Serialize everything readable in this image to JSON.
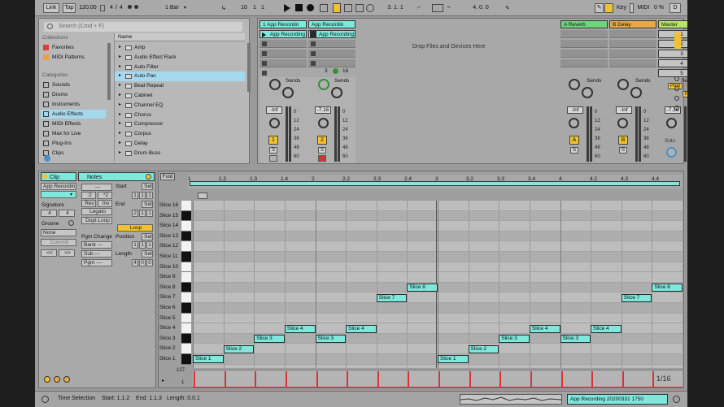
{
  "transport": {
    "link": "Link",
    "tap": "Tap",
    "tempo": "120.00",
    "sig_num": "4",
    "sig_den": "4",
    "quantize": "1 Bar",
    "arr_pos_a": "10",
    "arr_pos_b": "1",
    "arr_pos_c": "1",
    "loop_start": "3. 1. 1",
    "loop_len": "4. 0. 0",
    "key": "Key",
    "midi": "MIDI",
    "cpu": "0 %",
    "d_label": "D"
  },
  "browser": {
    "search_placeholder": "Search (Cmd + F)",
    "collections_head": "Collections",
    "collections": [
      {
        "label": "Favorites",
        "color": "#e03a3a"
      },
      {
        "label": "MIDI Patterns",
        "color": "#e8a03a"
      }
    ],
    "categories_head": "Categories",
    "categories": [
      "Sounds",
      "Drums",
      "Instruments",
      "Audio Effects",
      "MIDI Effects",
      "Max for Live",
      "Plug-Ins",
      "Clips"
    ],
    "selected_category": "Audio Effects",
    "name_head": "Name",
    "items": [
      "Amp",
      "Audio Effect Rack",
      "Auto Filter",
      "Auto Pan",
      "Beat Repeat",
      "Cabinet",
      "Channel EQ",
      "Chorus",
      "Compressor",
      "Corpus",
      "Delay",
      "Drum Buss"
    ],
    "selected_item": "Auto Pan"
  },
  "session": {
    "drop_hint": "Drop Files and Devices Here",
    "tracks": [
      {
        "name": "1 App Recordin",
        "clip": "App Recording",
        "num": "1",
        "vol": "-Inf",
        "color": "#7ee8dc"
      },
      {
        "name": "App Recordin",
        "clip": "App Recording",
        "num": "2",
        "vol": "-7.16",
        "color": "#7ee8dc"
      }
    ],
    "returns": [
      {
        "name": "A Reverb",
        "num": "A",
        "vol": "-Inf",
        "color": "#6ed67a"
      },
      {
        "name": "B Delay",
        "num": "B",
        "vol": "-Inf",
        "color": "#e8a848"
      }
    ],
    "master": {
      "name": "Master",
      "vol": "-7.16",
      "scenes": [
        "1",
        "2",
        "3",
        "4",
        "5"
      ],
      "post": "Post",
      "solo": "Solo"
    },
    "sends_label": "Sends",
    "db_marks": [
      "0",
      "12",
      "24",
      "36",
      "48",
      "60"
    ],
    "track2_extra": {
      "a": "3",
      "b": "16"
    },
    "s_btn": "S"
  },
  "clip_view": {
    "clip_head": "Clip",
    "notes_head": "Notes",
    "clip_name": "App Recordin",
    "signature_label": "Signature",
    "sig_num": "4",
    "sig_den": "4",
    "groove_label": "Groove",
    "groove_value": "None",
    "commit": "Commit",
    "nudge_l": "<<",
    "nudge_r": ">>",
    "notes_box": "---",
    "div2": ":2",
    "mul2": "*2",
    "rev": "Rev",
    "inv": "Inv",
    "legato": "Legato",
    "dupl": "Dupl.Loop",
    "pgm_change": "Pgm Change",
    "bank": "Bank ---",
    "sub": "Sub ---",
    "pgm": "Pgm ---",
    "start_label": "Start",
    "end_label": "End",
    "set": "Set",
    "start": [
      "1",
      "1",
      "1"
    ],
    "end": [
      "2",
      "1",
      "1"
    ],
    "loop": "Loop",
    "position_label": "Position",
    "position": [
      "1",
      "1",
      "1"
    ],
    "length_label": "Length",
    "length": [
      "4",
      "0",
      "0"
    ]
  },
  "piano_roll": {
    "fold": "Fold",
    "ruler": [
      "1",
      "1.2",
      "1.3",
      "1.4",
      "2",
      "2.2",
      "2.3",
      "2.4",
      "3",
      "3.2",
      "3.3",
      "3.4",
      "4",
      "4.2",
      "4.3",
      "4.4"
    ],
    "keys": [
      "Slice 16",
      "Slice 15",
      "Slice 14",
      "Slice 13",
      "Slice 12",
      "Slice 11",
      "Slice 10",
      "Slice 9",
      "Slice 8",
      "Slice 7",
      "Slice 6",
      "Slice 5",
      "Slice 4",
      "Slice 3",
      "Slice 2",
      "Slice 1"
    ],
    "notes": [
      {
        "label": "Slice 1",
        "slice": 1,
        "start": 0.0,
        "len": 1.0
      },
      {
        "label": "Slice 2",
        "slice": 2,
        "start": 1.0,
        "len": 1.0
      },
      {
        "label": "Slice 3",
        "slice": 3,
        "start": 2.0,
        "len": 1.0
      },
      {
        "label": "Slice 4",
        "slice": 4,
        "start": 3.0,
        "len": 1.0
      },
      {
        "label": "Slice 3",
        "slice": 3,
        "start": 4.0,
        "len": 1.0
      },
      {
        "label": "Slice 4",
        "slice": 4,
        "start": 5.0,
        "len": 1.0
      },
      {
        "label": "Slice 7",
        "slice": 7,
        "start": 6.0,
        "len": 1.0
      },
      {
        "label": "Slice 8",
        "slice": 8,
        "start": 7.0,
        "len": 1.0
      },
      {
        "label": "Slice 1",
        "slice": 1,
        "start": 8.0,
        "len": 1.0
      },
      {
        "label": "Slice 2",
        "slice": 2,
        "start": 9.0,
        "len": 1.0
      },
      {
        "label": "Slice 3",
        "slice": 3,
        "start": 10.0,
        "len": 1.0
      },
      {
        "label": "Slice 4",
        "slice": 4,
        "start": 11.0,
        "len": 1.0
      },
      {
        "label": "Slice 3",
        "slice": 3,
        "start": 12.0,
        "len": 1.0
      },
      {
        "label": "Slice 4",
        "slice": 4,
        "start": 13.0,
        "len": 1.0
      },
      {
        "label": "Slice 7",
        "slice": 7,
        "start": 14.0,
        "len": 1.0
      },
      {
        "label": "Slice 8",
        "slice": 8,
        "start": 15.0,
        "len": 1.0
      }
    ],
    "vel_max": "127",
    "vel_min": "1",
    "zoom": "1/16"
  },
  "status": {
    "time_selection": "Time Selection",
    "start": "Start: 1.1.2",
    "end": "End: 1.1.3",
    "length": "Length: 0.0.1",
    "recording": "App Recording 20200331 1750"
  }
}
